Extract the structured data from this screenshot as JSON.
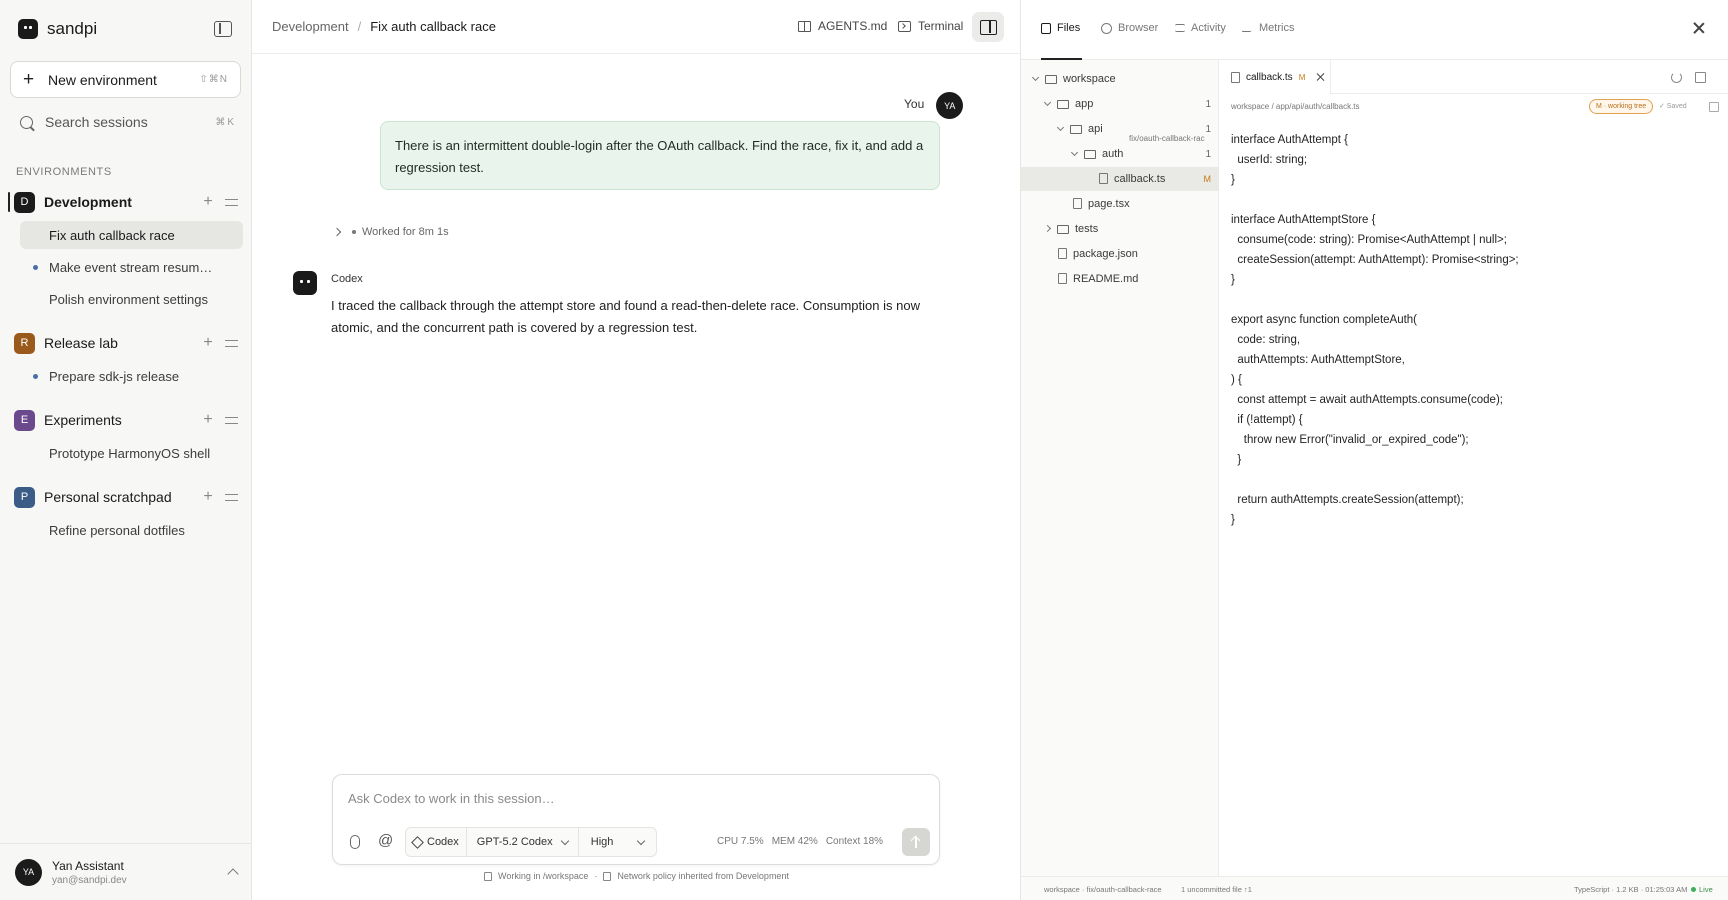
{
  "app": {
    "name": "sandpi"
  },
  "sidebar": {
    "new_environment": {
      "label": "New environment",
      "shortcut": "⇧⌘N"
    },
    "search": {
      "placeholder": "Search sessions",
      "shortcut": "⌘K"
    },
    "environments_heading": "ENVIRONMENTS",
    "environments": [
      {
        "initial": "D",
        "name": "Development",
        "color": "#1b1b1b",
        "sessions": [
          {
            "label": "Fix auth callback race",
            "active": true,
            "dot": false
          },
          {
            "label": "Make event stream resum…",
            "active": false,
            "dot": true
          },
          {
            "label": "Polish environment settings",
            "active": false,
            "dot": false
          }
        ]
      },
      {
        "initial": "R",
        "name": "Release lab",
        "color": "#9a5a1c",
        "sessions": [
          {
            "label": "Prepare sdk-js release",
            "active": false,
            "dot": true
          }
        ]
      },
      {
        "initial": "E",
        "name": "Experiments",
        "color": "#6a4a8c",
        "sessions": [
          {
            "label": "Prototype HarmonyOS shell",
            "active": false,
            "dot": false
          }
        ]
      },
      {
        "initial": "P",
        "name": "Personal scratchpad",
        "color": "#3b5c86",
        "sessions": [
          {
            "label": "Refine personal dotfiles",
            "active": false,
            "dot": false
          }
        ]
      }
    ],
    "user": {
      "initials": "YA",
      "name": "Yan Assistant",
      "email": "yan@sandpi.dev"
    }
  },
  "header": {
    "breadcrumb": [
      "Development",
      "Fix auth callback race"
    ],
    "breadcrumb_sep": "/",
    "agents_label": "AGENTS.md",
    "terminal_label": "Terminal"
  },
  "chat": {
    "you_label": "You",
    "you_initials": "YA",
    "user_message": "There is an intermittent double-login after the OAuth callback. Find the race, fix it, and add a regression test.",
    "worked_label": "Worked for 8m 1s",
    "assistant_name": "Codex",
    "assistant_message": "I traced the callback through the attempt store and found a read-then-delete race. Consumption is now atomic, and the concurrent path is covered by a regression test."
  },
  "composer": {
    "placeholder": "Ask Codex to work in this session…",
    "agent": "Codex",
    "model": "GPT-5.2 Codex",
    "effort": "High",
    "cpu": "CPU 7.5%",
    "mem": "MEM 42%",
    "context": "Context 18%",
    "footnote_workdir": "Working in /workspace",
    "footnote_sep": "·",
    "footnote_policy": "Network policy inherited from Development"
  },
  "panel": {
    "tabs": [
      {
        "label": "Files",
        "icon": "file-icon",
        "active": true
      },
      {
        "label": "Browser",
        "icon": "globe-icon",
        "active": false
      },
      {
        "label": "Activity",
        "icon": "activity-icon",
        "active": false
      },
      {
        "label": "Metrics",
        "icon": "metrics-icon",
        "active": false
      }
    ],
    "branch_tag": "fix/oauth-callback-rac",
    "tree": [
      {
        "label": "workspace",
        "kind": "folder",
        "depth": 0,
        "expanded": true,
        "count": ""
      },
      {
        "label": "app",
        "kind": "folder",
        "depth": 1,
        "expanded": true,
        "count": "1"
      },
      {
        "label": "api",
        "kind": "folder",
        "depth": 2,
        "expanded": true,
        "count": "1"
      },
      {
        "label": "auth",
        "kind": "folder",
        "depth": 3,
        "expanded": true,
        "count": "1"
      },
      {
        "label": "callback.ts",
        "kind": "file",
        "depth": 4,
        "selected": true,
        "mod": "M"
      },
      {
        "label": "page.tsx",
        "kind": "file",
        "depth": 2
      },
      {
        "label": "tests",
        "kind": "folder",
        "depth": 1,
        "expanded": false,
        "count": ""
      },
      {
        "label": "package.json",
        "kind": "file",
        "depth": 0
      },
      {
        "label": "README.md",
        "kind": "file",
        "depth": 0
      }
    ],
    "open_file": {
      "name": "callback.ts",
      "mod": "M"
    },
    "path": "workspace / app/api/auth/callback.ts",
    "working_tree_badge": "M · working tree",
    "saved_label": "✓ Saved",
    "code_lines": [
      "interface AuthAttempt {",
      "  userId: string;",
      "}",
      "",
      "interface AuthAttemptStore {",
      "  consume(code: string): Promise<AuthAttempt | null>;",
      "  createSession(attempt: AuthAttempt): Promise<string>;",
      "}",
      "",
      "export async function completeAuth(",
      "  code: string,",
      "  authAttempts: AuthAttemptStore,",
      ") {",
      "  const attempt = await authAttempts.consume(code);",
      "  if (!attempt) {",
      "    throw new Error(\"invalid_or_expired_code\");",
      "  }",
      "",
      "  return authAttempts.createSession(attempt);",
      "}"
    ],
    "status": {
      "branch": "workspace · fix/oauth-callback-race",
      "uncommitted": "1 uncommitted file ↑1",
      "file_info": "TypeScript · 1.2 KB · 01:25:03 AM",
      "live": "Live"
    }
  }
}
